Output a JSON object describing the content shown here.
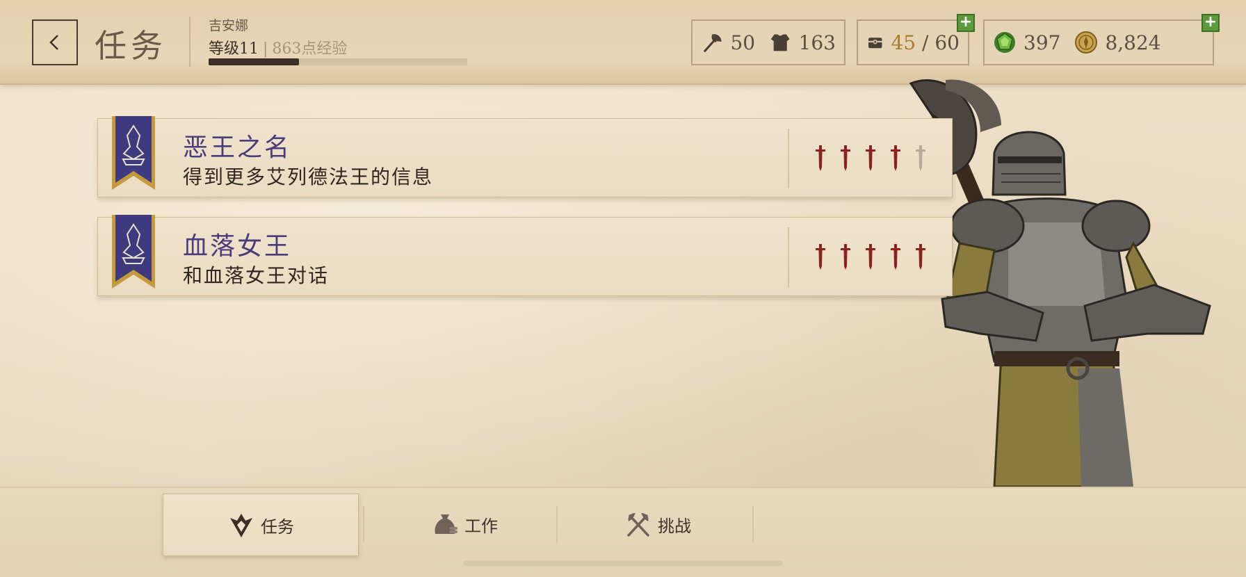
{
  "header": {
    "title": "任务",
    "player_name": "吉安娜",
    "level": "等级11",
    "separator": "|",
    "xp_text": "863点经验",
    "xp_progress": 0.35
  },
  "resources": {
    "attack": "50",
    "armor": "163",
    "inventory": "45",
    "inventory_sep": "/",
    "inventory_max": "60",
    "gems": "397",
    "gold": "8,824"
  },
  "quests": [
    {
      "title": "恶王之名",
      "description": "得到更多艾列德法王的信息",
      "difficulty": 4,
      "max_difficulty": 5
    },
    {
      "title": "血落女王",
      "description": "和血落女王对话",
      "difficulty": 5,
      "max_difficulty": 5
    }
  ],
  "tabs": [
    {
      "label": "任务",
      "icon": "quest-icon",
      "active": true
    },
    {
      "label": "工作",
      "icon": "money-bag-icon",
      "active": false
    },
    {
      "label": "挑战",
      "icon": "crossed-axes-icon",
      "active": false
    }
  ],
  "colors": {
    "quest_title": "#4a3c7a",
    "sword_active": "#8e2020",
    "sword_inactive": "#b8aa98",
    "banner": "#3d3a7e",
    "banner_trim": "#c59a3c",
    "plus_button": "#5d9b3a"
  }
}
